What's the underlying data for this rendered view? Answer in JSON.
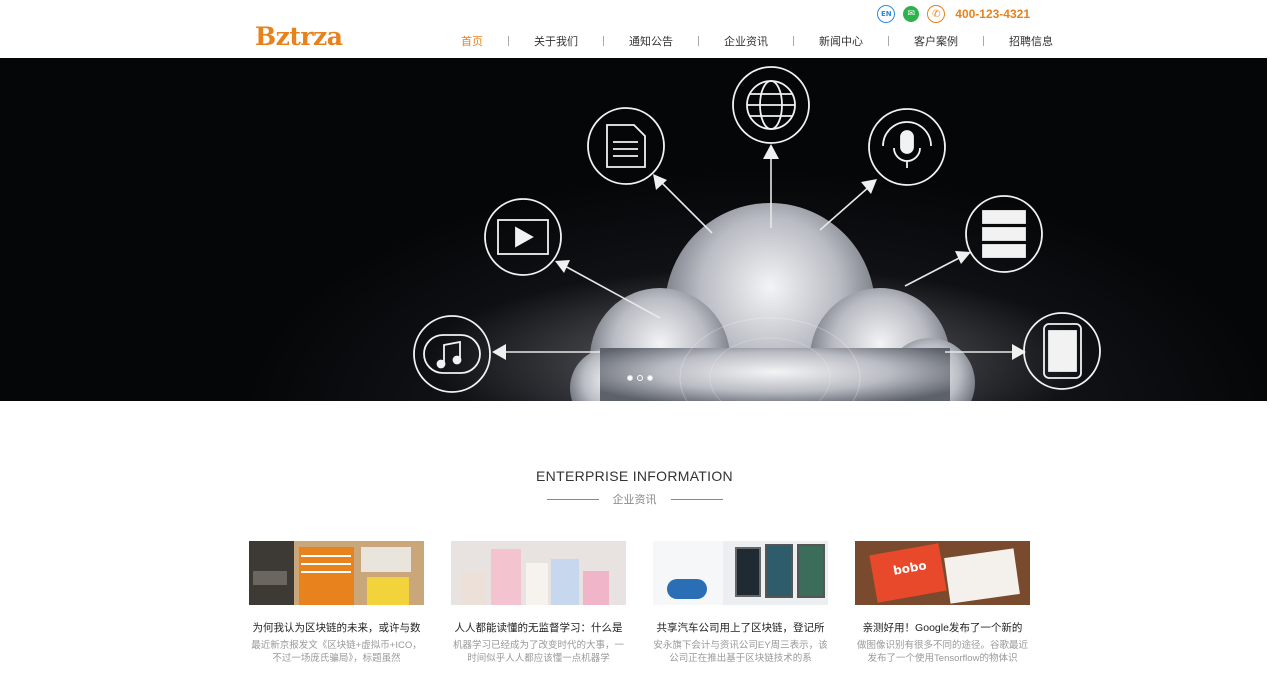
{
  "header": {
    "logo": "Bztrza",
    "lang_badge": "EN",
    "phone": "400-123-4321",
    "nav": [
      {
        "label": "首页",
        "active": true
      },
      {
        "label": "关于我们"
      },
      {
        "label": "通知公告"
      },
      {
        "label": "企业资讯"
      },
      {
        "label": "新闻中心"
      },
      {
        "label": "客户案例"
      },
      {
        "label": "招聘信息"
      }
    ]
  },
  "banner": {
    "slide_count": 3,
    "active_slide": 1
  },
  "section": {
    "title": "ENTERPRISE INFORMATION",
    "subtitle": "企业资讯"
  },
  "cards": [
    {
      "title": "为何我认为区块链的未来，或许与数",
      "desc": "最近新京报发文《区块链+虚拟币+ICO，不过一场庞氏骗局》，标题虽然"
    },
    {
      "title": "人人都能读懂的无监督学习：什么是",
      "desc": "机器学习已经成为了改变时代的大事，一时间似乎人人都应该懂一点机器学"
    },
    {
      "title": "共享汽车公司用上了区块链，登记所",
      "desc": "安永旗下会计与资讯公司EY周三表示，该公司正在推出基于区块链技术的系"
    },
    {
      "title": "亲测好用！Google发布了一个新的",
      "desc": "做图像识别有很多不同的途径。谷歌最近发布了一个使用Tensorflow的物体识"
    }
  ],
  "colors": {
    "accent": "#e8821c",
    "wechat": "#2eb24e",
    "lang": "#2a8be0"
  }
}
